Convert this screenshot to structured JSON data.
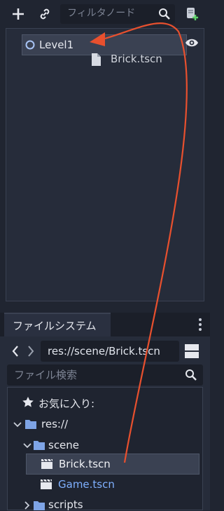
{
  "scene_dock": {
    "filter_placeholder": "フィルタノード",
    "root_node": "Level1",
    "child_node": "Brick.tscn"
  },
  "filesystem": {
    "tab_label": "ファイルシステム",
    "path_value": "res://scene/Brick.tscn",
    "search_placeholder": "ファイル検索",
    "favorites_label": "お気に入り:",
    "items": [
      {
        "label": "res://"
      },
      {
        "label": "scene"
      },
      {
        "label": "Brick.tscn"
      },
      {
        "label": "Game.tscn"
      },
      {
        "label": "scripts"
      }
    ]
  },
  "colors": {
    "accent": "#7fb0ff",
    "arrow": "#e8502e",
    "folder": "#7ea4e6"
  }
}
